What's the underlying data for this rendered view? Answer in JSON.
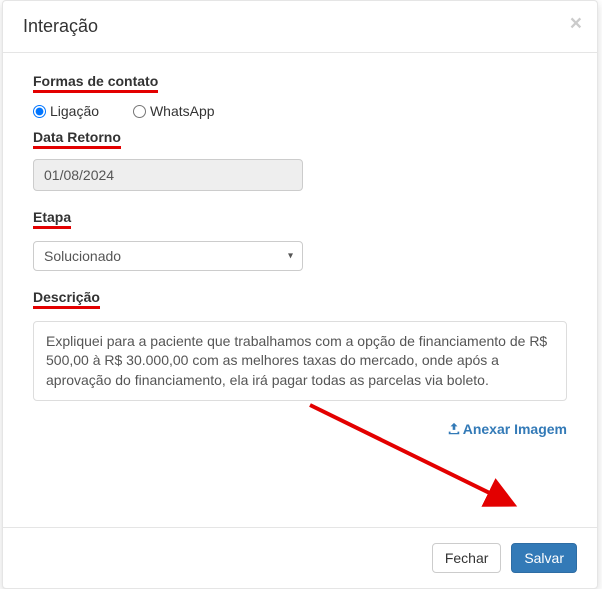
{
  "modal": {
    "title": "Interação",
    "close": "×"
  },
  "labels": {
    "formas_contato": "Formas de contato",
    "data_retorno": "Data Retorno",
    "etapa": "Etapa",
    "descricao": "Descrição"
  },
  "contato": {
    "options": {
      "ligacao": "Ligação",
      "whatsapp": "WhatsApp"
    },
    "selected": "ligacao"
  },
  "data_retorno": {
    "value": "01/08/2024"
  },
  "etapa": {
    "selected": "Solucionado"
  },
  "descricao": {
    "text": "Expliquei para a paciente que trabalhamos com a opção de financiamento de R$ 500,00 à R$ 30.000,00 com as melhores taxas do mercado, onde após a aprovação do financiamento, ela irá pagar todas as parcelas via boleto."
  },
  "attach": {
    "label": "Anexar Imagem"
  },
  "footer": {
    "close": "Fechar",
    "save": "Salvar"
  },
  "annotation": {
    "arrow_color": "#e30000"
  }
}
